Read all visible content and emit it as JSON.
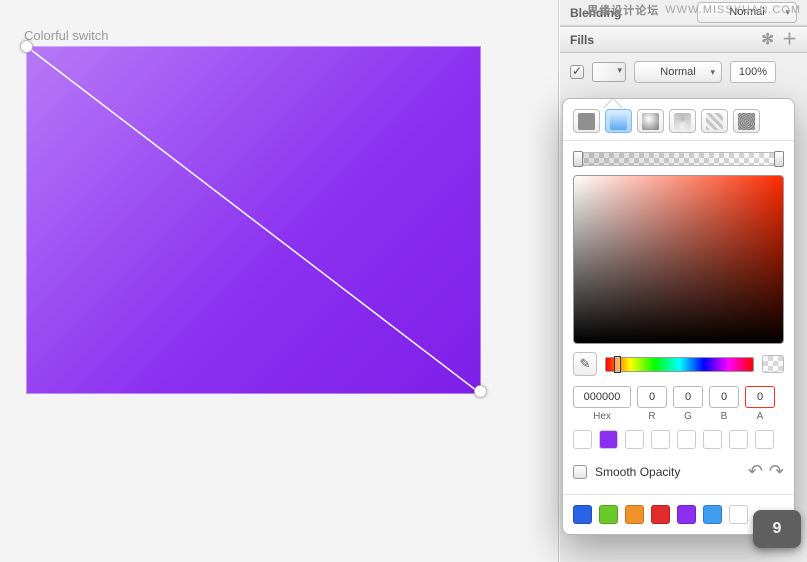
{
  "watermark": {
    "a": "思缘设计论坛",
    "b": "WWW.MISSYUAN.COM"
  },
  "canvas": {
    "layerLabel": "Colorful switch"
  },
  "blending": {
    "label": "Blending",
    "mode": "Normal"
  },
  "fills": {
    "title": "Fills",
    "row": {
      "mode": "Normal",
      "opacity": "100%"
    }
  },
  "popover": {
    "hex": "000000",
    "r": "0",
    "g": "0",
    "b": "0",
    "a": "0",
    "labels": {
      "hex": "Hex",
      "r": "R",
      "g": "G",
      "b": "B",
      "a": "A"
    },
    "smoothOpacity": "Smooth Opacity",
    "presetFilled": "#8a2ff0",
    "docColors": [
      "#2a62e6",
      "#6bc92b",
      "#f2922a",
      "#e02c2c",
      "#8a2ff0",
      "#3e9df0",
      "#ffffff"
    ]
  },
  "page": "9"
}
